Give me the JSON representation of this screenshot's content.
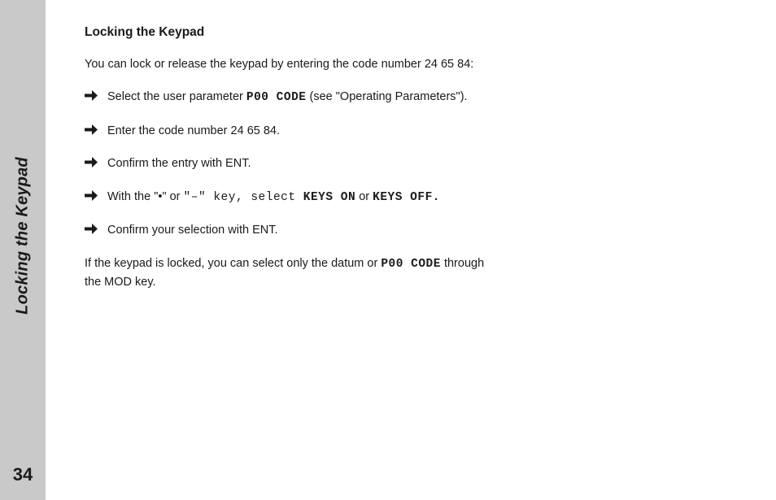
{
  "sidebar": {
    "title": "Locking the Keypad",
    "page_number": "34"
  },
  "content": {
    "heading": "Locking the Keypad",
    "intro": "You can lock or release the keypad by entering the code number 24 65 84:",
    "steps": [
      {
        "pre": "Select the user parameter ",
        "code": "P00 CODE",
        "post": " (see \"Operating Parameters\")."
      },
      {
        "pre": "Enter the code number 24 65 84.",
        "code": "",
        "post": ""
      },
      {
        "pre": "Confirm the entry with ENT.",
        "code": "",
        "post": ""
      }
    ],
    "step4": {
      "t1": "With the \"•\" or ",
      "t2": "\"–\" key, select ",
      "c1": "KEYS ON",
      "t3": " or ",
      "c2": "KEYS OFF."
    },
    "step5": "Confirm your selection with ENT.",
    "closing": {
      "t1": "If the keypad is locked, you can select only the datum or ",
      "c1": "P00 CODE",
      "t2": " through the MOD key."
    }
  }
}
